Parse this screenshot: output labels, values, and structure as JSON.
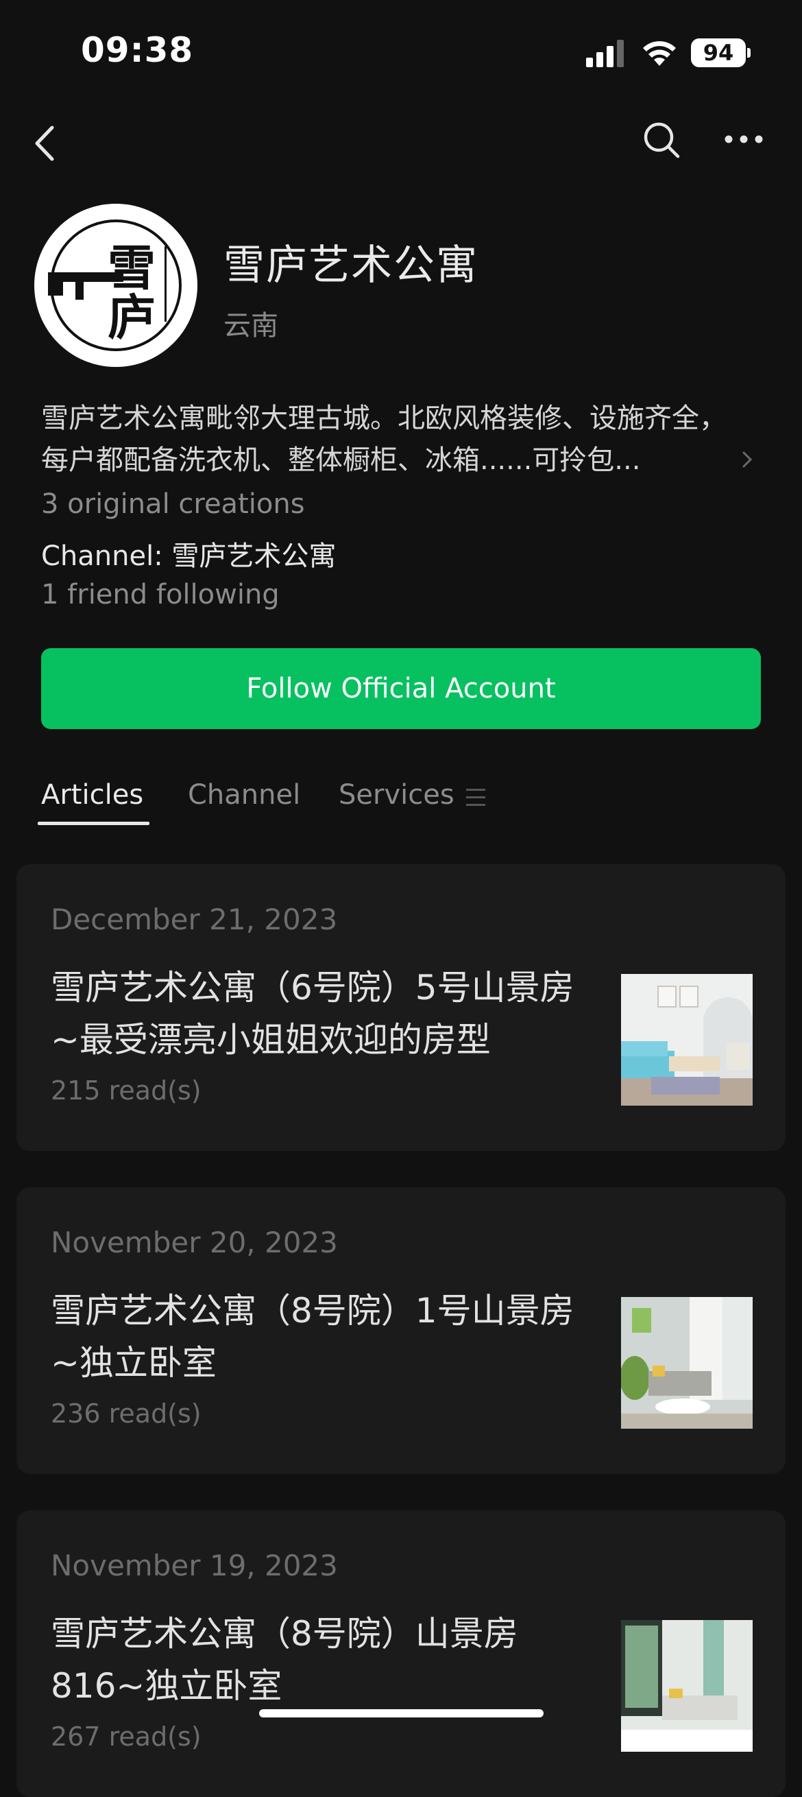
{
  "status_bar": {
    "time": "09:38",
    "battery": "94"
  },
  "account": {
    "name": "雪庐艺术公寓",
    "region": "云南",
    "description": "雪庐艺术公寓毗邻大理古城。北欧风格装修、设施齐全，每户都配备洗衣机、整体橱柜、冰箱......可拎包...",
    "original_creations": "3 original creations",
    "channel": "Channel: 雪庐艺术公寓",
    "friends_following": "1 friend following",
    "follow_label": "Follow Official Account"
  },
  "tabs": [
    {
      "label": "Articles"
    },
    {
      "label": "Channel"
    },
    {
      "label": "Services"
    }
  ],
  "articles": [
    {
      "date": "December 21, 2023",
      "title": "雪庐艺术公寓（6号院）5号山景房~最受漂亮小姐姐欢迎的房型",
      "reads": "215 read(s)"
    },
    {
      "date": "November 20, 2023",
      "title": "雪庐艺术公寓（8号院）1号山景房~独立卧室",
      "reads": "236 read(s)"
    },
    {
      "date": "November 19, 2023",
      "title": "雪庐艺术公寓（8号院）山景房816~独立卧室",
      "reads": "267 read(s)"
    }
  ],
  "colors": {
    "accent": "#07c160",
    "background": "#111111",
    "card": "#1b1b1b"
  },
  "icons": [
    "back-chevron-icon",
    "search-icon",
    "more-icon",
    "signal-icon",
    "wifi-icon",
    "battery-icon",
    "menu-icon",
    "chevron-right-icon"
  ]
}
